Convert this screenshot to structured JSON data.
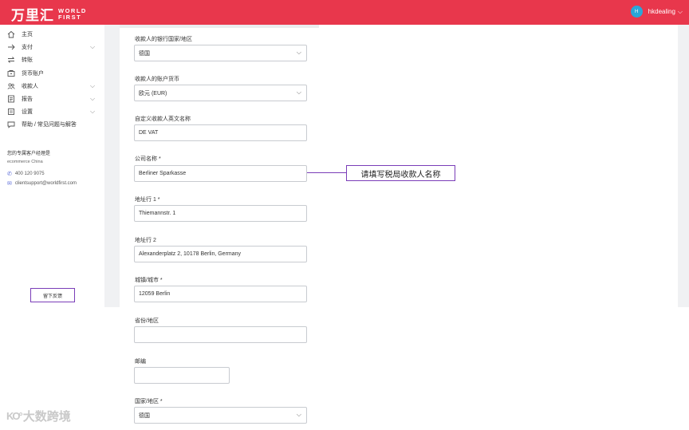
{
  "brand": {
    "cn": "万里汇",
    "en_line1": "WORLD",
    "en_line2": "FIRST",
    "color": "#e8374c"
  },
  "user": {
    "avatar_text": "H",
    "name": "hkdealing"
  },
  "sidebar": {
    "items": [
      {
        "label": "主页",
        "icon": "home-icon",
        "has_arrow": false
      },
      {
        "label": "支付",
        "icon": "arrow-right-icon",
        "has_arrow": true
      },
      {
        "label": "转账",
        "icon": "transfer-icon",
        "has_arrow": false
      },
      {
        "label": "货币账户",
        "icon": "wallet-icon",
        "has_arrow": false
      },
      {
        "label": "收款人",
        "icon": "people-icon",
        "has_arrow": true
      },
      {
        "label": "报告",
        "icon": "report-icon",
        "has_arrow": true
      },
      {
        "label": "设置",
        "icon": "settings-icon",
        "has_arrow": true
      },
      {
        "label": "帮助 / 常见问题与解答",
        "icon": "help-icon",
        "has_arrow": false
      }
    ],
    "contact": {
      "title": "您的专属客户经理是",
      "team": "ecommerce China",
      "phone": "400 120 9075",
      "email": "clientsupport@worldfirst.com"
    },
    "feedback_label": "留下反馈"
  },
  "form": {
    "fields": [
      {
        "label": "收款人的银行国家/地区",
        "value": "德国",
        "type": "select"
      },
      {
        "label": "收款人的账户货币",
        "value": "欧元 (EUR)",
        "type": "select"
      },
      {
        "label": "自定义收款人英文名称",
        "value": "DE VAT",
        "type": "text"
      },
      {
        "label": "公司名称 *",
        "value": "Berliner Sparkasse",
        "type": "text"
      },
      {
        "label": "地址行 1 *",
        "value": "Thiemannstr. 1",
        "type": "text"
      },
      {
        "label": "地址行 2",
        "value": "Alexanderplatz 2, 10178 Berlin, Germany",
        "type": "text"
      },
      {
        "label": "城镇/城市 *",
        "value": "12059 Berlin",
        "type": "text"
      },
      {
        "label": "省份/地区",
        "value": "",
        "type": "text"
      },
      {
        "label": "邮编",
        "value": "",
        "type": "text"
      },
      {
        "label": "国家/地区 *",
        "value": "德国",
        "type": "select"
      }
    ]
  },
  "annotation": {
    "text": "请填写税局收款人名称",
    "color": "#7a3db8"
  },
  "watermark": {
    "text": "大数跨境"
  }
}
